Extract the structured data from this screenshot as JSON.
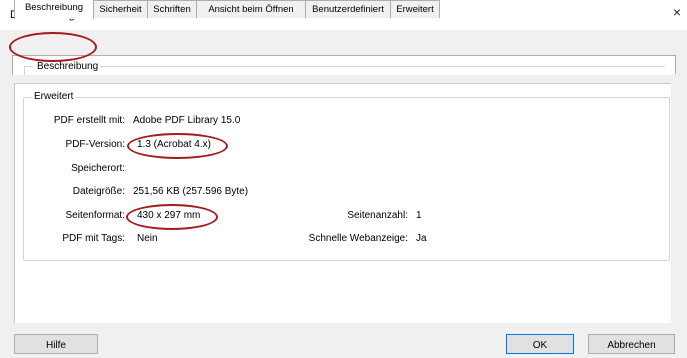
{
  "window": {
    "title": "Dokumenteigenschaften",
    "close": "×"
  },
  "tabs": [
    {
      "label": "Beschreibung"
    },
    {
      "label": "Sicherheit"
    },
    {
      "label": "Schriften"
    },
    {
      "label": "Ansicht beim Öffnen"
    },
    {
      "label": "Benutzerdefiniert"
    },
    {
      "label": "Erweitert"
    }
  ],
  "groups": {
    "description": "Beschreibung",
    "advanced": "Erweitert"
  },
  "props": {
    "created_with_label": "PDF erstellt mit:",
    "created_with_value": "Adobe PDF Library 15.0",
    "pdf_version_label": "PDF-Version:",
    "pdf_version_value": "1.3 (Acrobat 4.x)",
    "location_label": "Speicherort:",
    "location_value": "",
    "filesize_label": "Dateigröße:",
    "filesize_value": "251,56 KB (257.596 Byte)",
    "page_format_label": "Seitenformat:",
    "page_format_value": "430 x 297 mm",
    "page_count_label": "Seitenanzahl:",
    "page_count_value": "1",
    "tagged_label": "PDF mit Tags:",
    "tagged_value": "Nein",
    "fast_web_label": "Schnelle Webanzeige:",
    "fast_web_value": "Ja"
  },
  "buttons": {
    "help": "Hilfe",
    "ok": "OK",
    "cancel": "Abbrechen"
  },
  "annotation_color": "#a31b1b"
}
